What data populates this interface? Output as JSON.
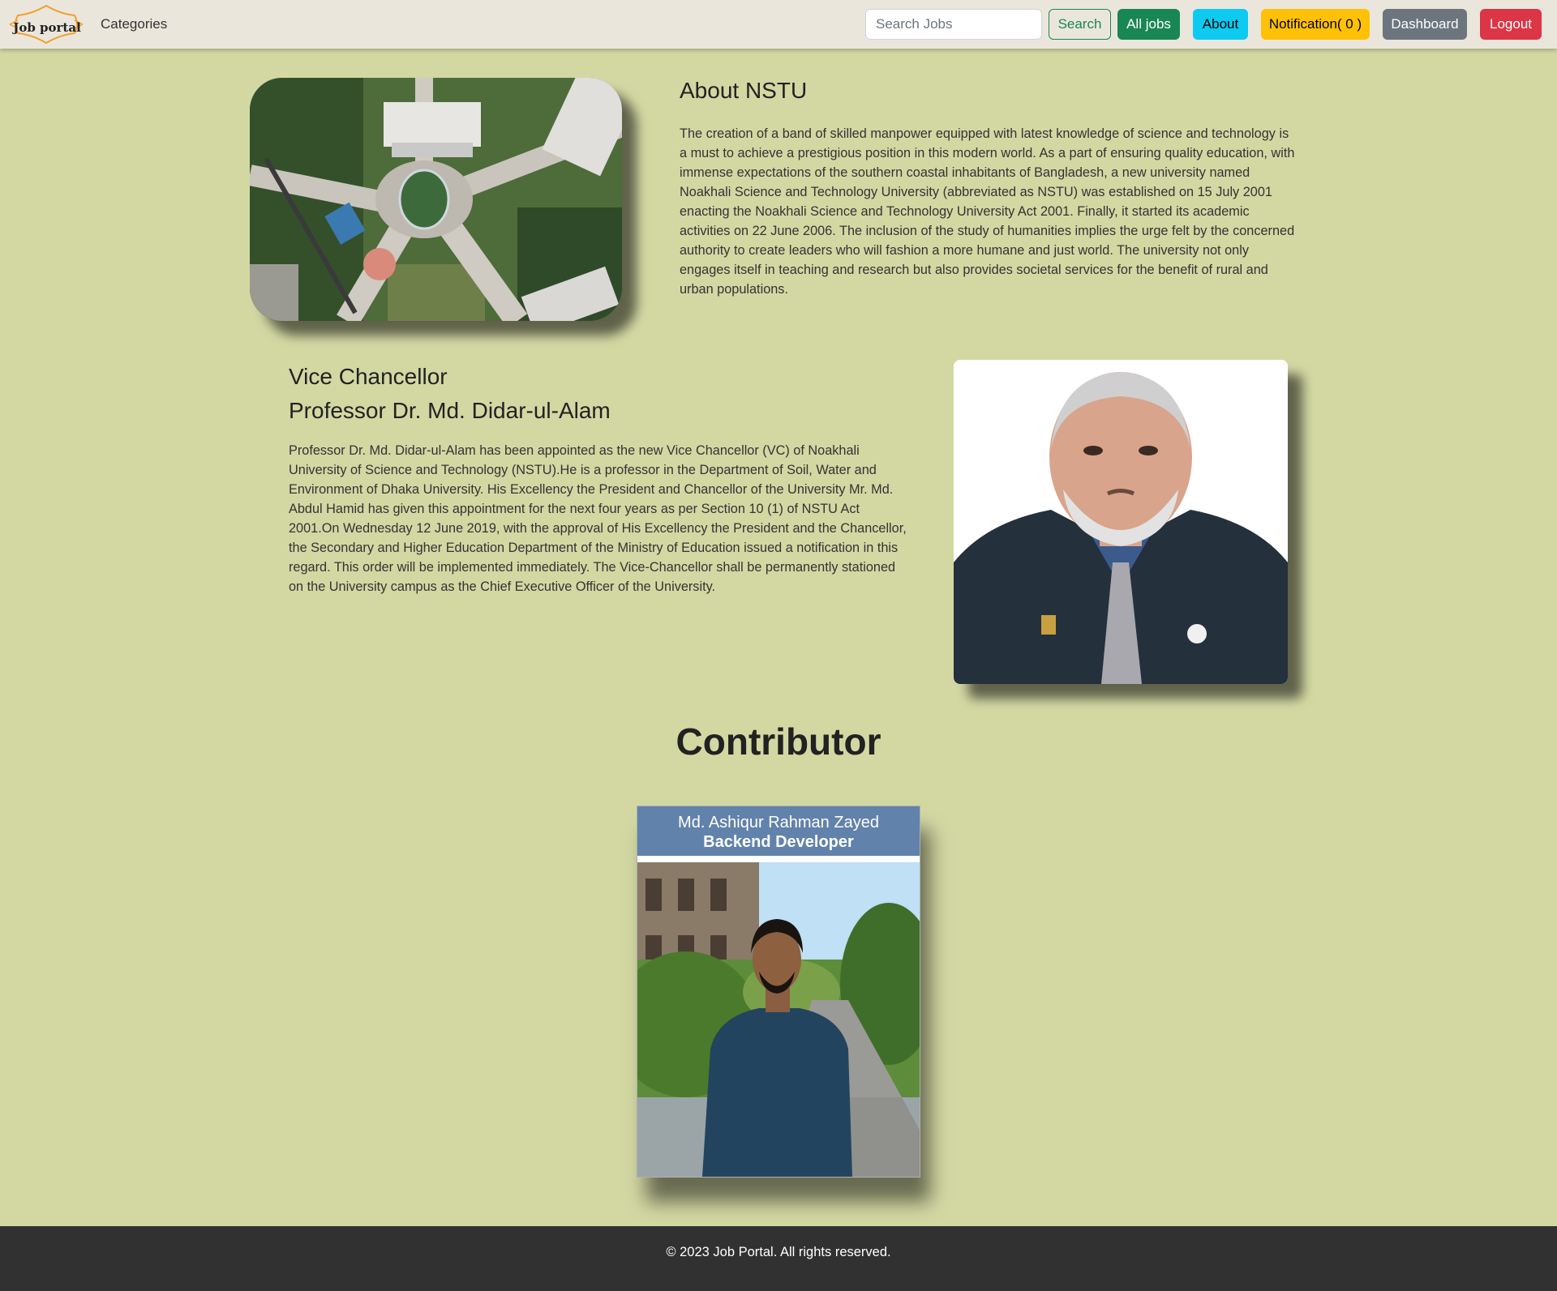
{
  "nav": {
    "logo_text": "Job portal",
    "categories": "Categories",
    "search_placeholder": "Search Jobs",
    "search_button": "Search",
    "all_jobs": "All jobs",
    "about": "About",
    "notification": "Notification( 0 )",
    "dashboard": "Dashboard",
    "logout": "Logout"
  },
  "about": {
    "title": "About NSTU",
    "text": "The creation of a band of skilled manpower equipped with latest knowledge of science and technology is a must to achieve a prestigious position in this modern world. As a part of ensuring quality education, with immense expectations of the southern coastal inhabitants of Bangladesh, a new university named Noakhali Science and Technology University (abbreviated as NSTU) was established on 15 July 2001 enacting the Noakhali Science and Technology University Act 2001. Finally, it started its academic activities on 22 June 2006. The inclusion of the study of humanities implies the urge felt by the concerned authority to create leaders who will fashion a more humane and just world. The university not only engages itself in teaching and research but also provides societal services for the benefit of rural and urban populations."
  },
  "vc": {
    "role": "Vice Chancellor",
    "name": "Professor Dr. Md. Didar-ul-Alam",
    "text": "Professor Dr. Md. Didar-ul-Alam has been appointed as the new Vice Chancellor (VC) of Noakhali University of Science and Technology (NSTU).He is a professor in the Department of Soil, Water and Environment of Dhaka University. His Excellency the President and Chancellor of the University Mr. Md. Abdul Hamid has given this appointment for the next four years as per Section 10 (1) of NSTU Act 2001.On Wednesday 12 June 2019, with the approval of His Excellency the President and the Chancellor, the Secondary and Higher Education Department of the Ministry of Education issued a notification in this regard. This order will be implemented immediately. The Vice-Chancellor shall be permanently stationed on the University campus as the Chief Executive Officer of the University."
  },
  "contributor": {
    "title": "Contributor",
    "name": "Md. Ashiqur Rahman Zayed",
    "role": "Backend Developer"
  },
  "footer": {
    "text": "© 2023 Job Portal. All rights reserved."
  },
  "colors": {
    "page_bg": "#d3d8a3",
    "navbar_bg": "#ebe6dc",
    "success": "#198754",
    "info": "#0dcaf0",
    "warning": "#ffc107",
    "secondary": "#6c757d",
    "danger": "#dc3545",
    "card_header": "#6182aa",
    "footer_bg": "#313131"
  }
}
